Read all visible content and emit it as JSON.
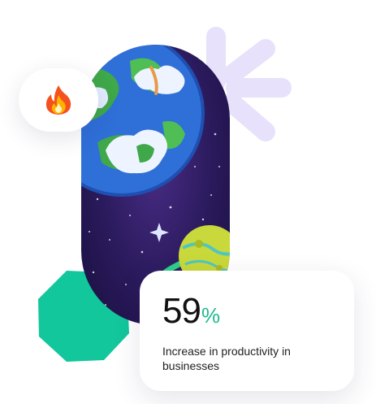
{
  "stat": {
    "value": "59",
    "unit": "%",
    "caption": "Increase in productivity in businesses"
  },
  "badge": {
    "icon": "fire-icon"
  },
  "colors": {
    "accent_green": "#1fb98f",
    "octagon_green": "#12c79b",
    "asterisk_lavender": "#e7e1fb",
    "space_purple": "#2a1a5c"
  }
}
